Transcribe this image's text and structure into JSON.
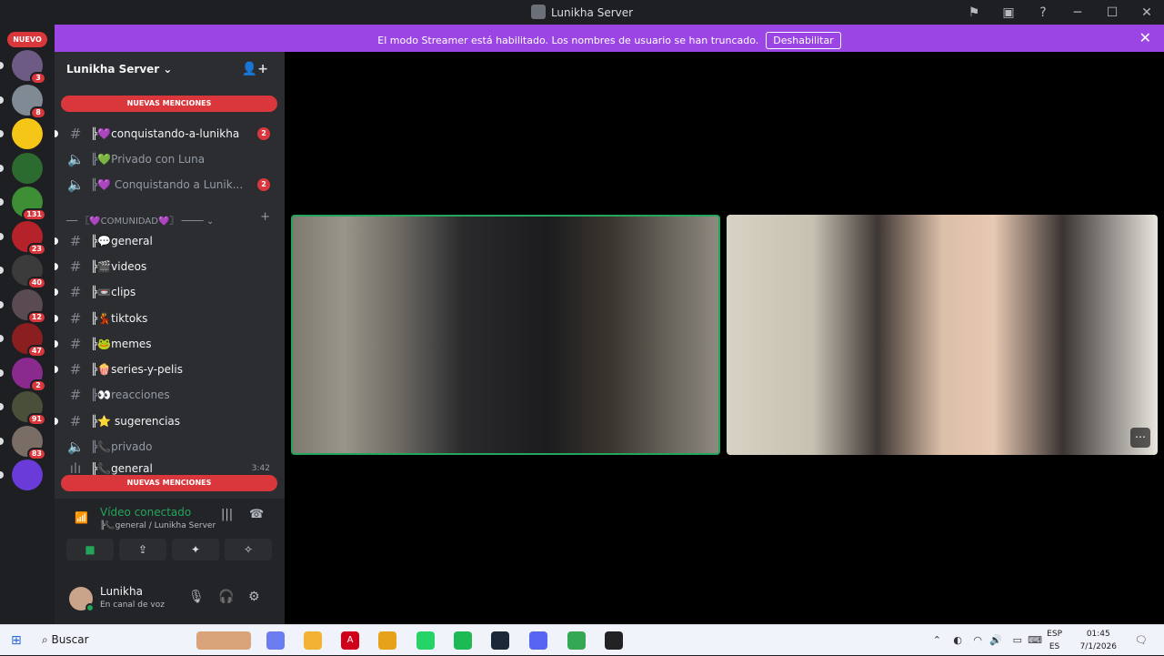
{
  "window": {
    "title": "Lunikha Server"
  },
  "banner": {
    "text": "El modo Streamer está habilitado. Los nombres de usuario se han truncado.",
    "button": "Deshabilitar"
  },
  "servers": {
    "new_label": "NUEVO",
    "items": [
      {
        "badge": "3",
        "color": "#6d5b86"
      },
      {
        "badge": "8",
        "color": "#7f8a95"
      },
      {
        "badge": "",
        "color": "#f5c518"
      },
      {
        "badge": "",
        "color": "#2c6b2f"
      },
      {
        "badge": "131",
        "color": "#3e8e36"
      },
      {
        "badge": "23",
        "color": "#b5222a"
      },
      {
        "badge": "40",
        "color": "#3b3b3b"
      },
      {
        "badge": "12",
        "color": "#5a4b53"
      },
      {
        "badge": "47",
        "color": "#8b1e1e"
      },
      {
        "badge": "2",
        "color": "#8a2a8f"
      },
      {
        "badge": "91",
        "color": "#4a4f3a"
      },
      {
        "badge": "83",
        "color": "#7a6d66"
      },
      {
        "badge": "",
        "color": "#6a3bd8"
      }
    ]
  },
  "sidebar": {
    "server_name": "Lunikha Server",
    "mentions_top": "NUEVAS MENCIONES",
    "mentions_bottom": "NUEVAS MENCIONES",
    "category": "── 〖💜COMUNIDAD💜〗 ──── ⌄",
    "channels": [
      {
        "name": "╠💜conquistando-a-lunikha",
        "count": "2",
        "type": "text",
        "unread": true
      },
      {
        "name": "╠💚Privado con Luna",
        "count": "",
        "type": "voice",
        "unread": false
      },
      {
        "name": "╠💜 Conquistando a Lunik...",
        "count": "2",
        "type": "voice",
        "unread": false
      },
      {
        "name": "╠💬general",
        "count": "",
        "type": "text",
        "unread": true
      },
      {
        "name": "╠🎬videos",
        "count": "",
        "type": "text",
        "unread": true
      },
      {
        "name": "╠📼clips",
        "count": "",
        "type": "text",
        "unread": true
      },
      {
        "name": "╠💃tiktoks",
        "count": "",
        "type": "text",
        "unread": true
      },
      {
        "name": "╠🐸memes",
        "count": "",
        "type": "text",
        "unread": true
      },
      {
        "name": "╠🍿series-y-pelis",
        "count": "",
        "type": "text",
        "unread": true
      },
      {
        "name": "╠👀reacciones",
        "count": "",
        "type": "text",
        "unread": false
      },
      {
        "name": "╠⭐ sugerencias",
        "count": "",
        "type": "text",
        "unread": true
      },
      {
        "name": "╠📞privado",
        "count": "",
        "type": "voice",
        "unread": false
      }
    ],
    "partial_channel": {
      "name": "╠📞general",
      "time": "3:42"
    }
  },
  "voice": {
    "status": "Vídeo conectado",
    "location": "╠📞general / Lunikha Server"
  },
  "user": {
    "name": "Lunikha",
    "status": "En canal de voz"
  },
  "taskbar": {
    "search": "Buscar",
    "lang_top": "ESP",
    "lang_bottom": "ES",
    "time": "01:45",
    "date": "7/1/2026"
  }
}
